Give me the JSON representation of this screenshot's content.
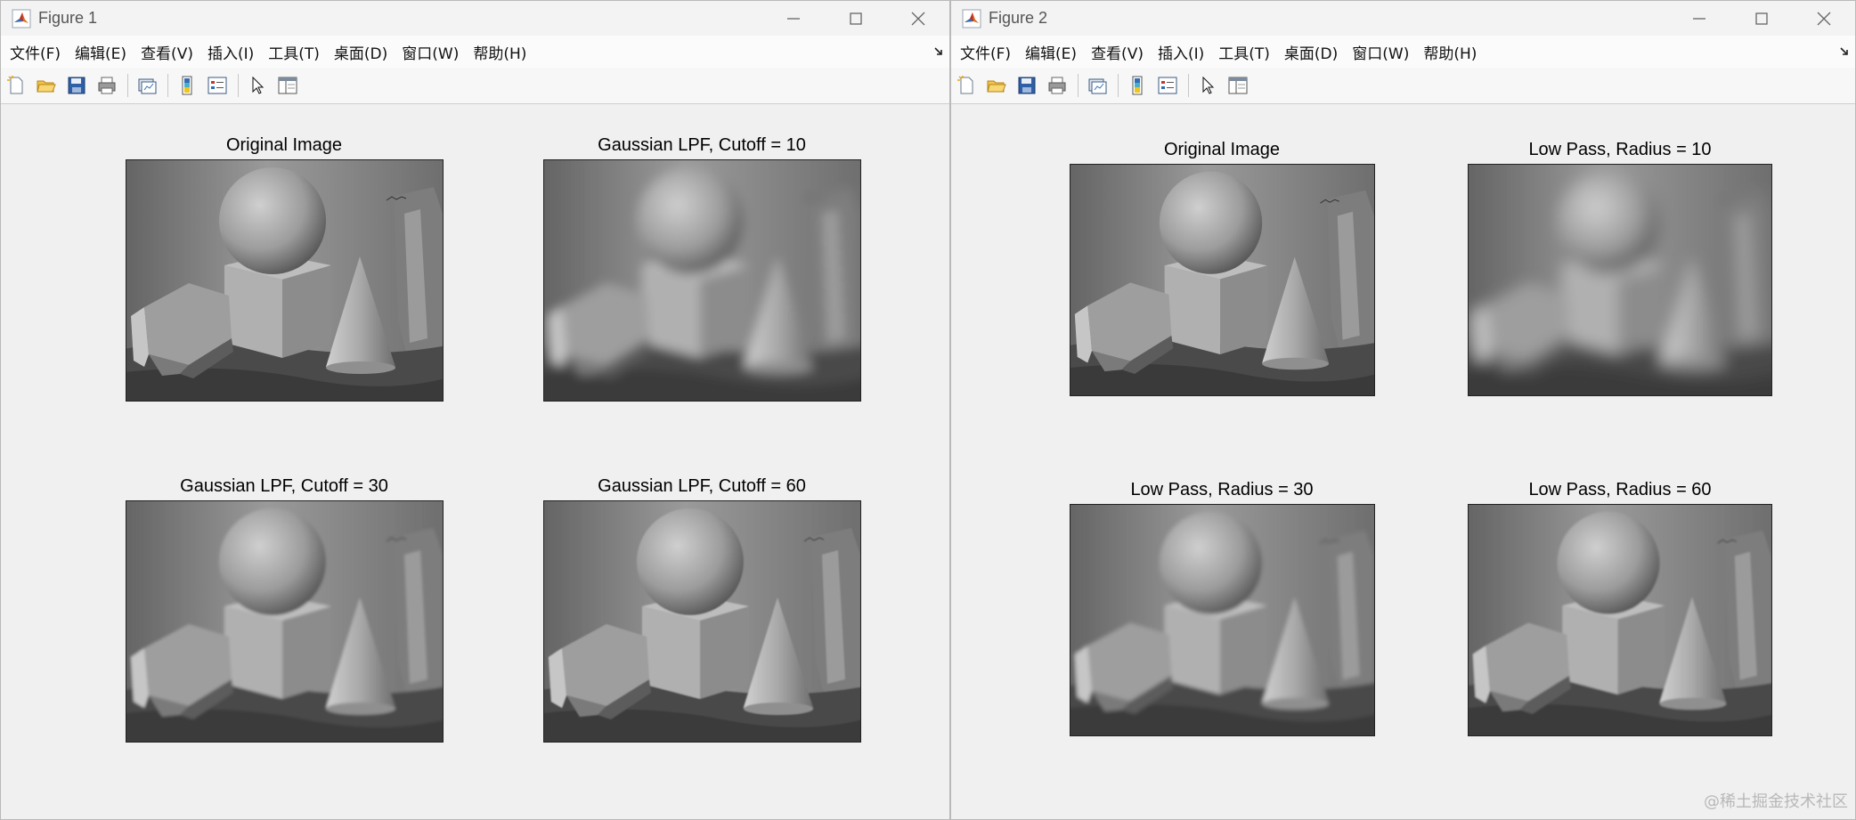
{
  "windows": [
    {
      "title": "Figure 1",
      "menu": [
        "文件(F)",
        "编辑(E)",
        "查看(V)",
        "插入(I)",
        "工具(T)",
        "桌面(D)",
        "窗口(W)",
        "帮助(H)"
      ],
      "plots": [
        {
          "title": "Original Image",
          "blur": 0
        },
        {
          "title": "Gaussian LPF, Cutoff = 10",
          "blur": 6
        },
        {
          "title": "Gaussian LPF, Cutoff = 30",
          "blur": 1.6
        },
        {
          "title": "Gaussian LPF, Cutoff = 60",
          "blur": 0.7
        }
      ]
    },
    {
      "title": "Figure 2",
      "menu": [
        "文件(F)",
        "编辑(E)",
        "查看(V)",
        "插入(I)",
        "工具(T)",
        "桌面(D)",
        "窗口(W)",
        "帮助(H)"
      ],
      "plots": [
        {
          "title": "Original Image",
          "blur": 0
        },
        {
          "title": "Low Pass, Radius = 10",
          "blur": 9
        },
        {
          "title": "Low Pass, Radius = 30",
          "blur": 2.4
        },
        {
          "title": "Low Pass, Radius = 60",
          "blur": 1.1
        }
      ]
    }
  ],
  "watermark": "@稀土掘金技术社区",
  "colors": {
    "matlab_orange": "#e06a1c",
    "matlab_red": "#b7302b",
    "window_bg": "#f0f0f0"
  }
}
